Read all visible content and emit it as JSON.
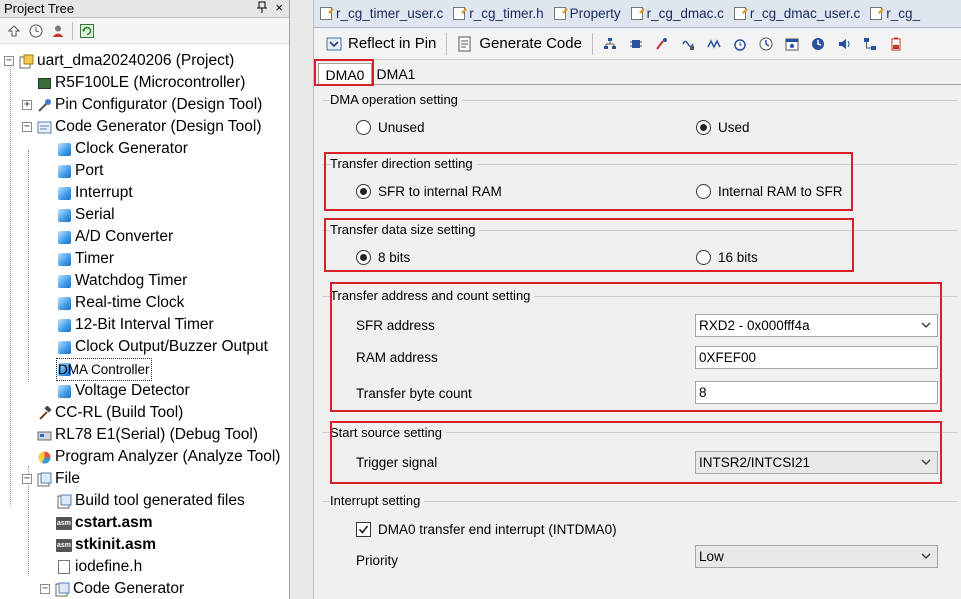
{
  "project_tree": {
    "title": "Project Tree",
    "pin_icon": "pin-icon",
    "close_label": "×",
    "nodes": [
      {
        "label": "uart_dma20240206 (Project)",
        "icon": "project-icon"
      },
      {
        "label": "R5F100LE (Microcontroller)",
        "icon": "microcontroller-icon"
      },
      {
        "label": "Pin Configurator (Design Tool)",
        "icon": "pin-configurator-icon"
      },
      {
        "label": "Code Generator (Design Tool)",
        "icon": "code-generator-icon"
      },
      {
        "label": "Clock Generator",
        "icon": "module-icon"
      },
      {
        "label": "Port",
        "icon": "module-icon"
      },
      {
        "label": "Interrupt",
        "icon": "module-icon"
      },
      {
        "label": "Serial",
        "icon": "module-icon"
      },
      {
        "label": "A/D Converter",
        "icon": "module-icon"
      },
      {
        "label": "Timer",
        "icon": "module-icon"
      },
      {
        "label": "Watchdog Timer",
        "icon": "module-icon"
      },
      {
        "label": "Real-time Clock",
        "icon": "module-icon"
      },
      {
        "label": "12-Bit Interval Timer",
        "icon": "module-icon"
      },
      {
        "label": "Clock Output/Buzzer Output",
        "icon": "module-icon"
      },
      {
        "label": "DMA Controller",
        "icon": "module-icon"
      },
      {
        "label": "Voltage Detector",
        "icon": "module-icon"
      },
      {
        "label": "CC-RL (Build Tool)",
        "icon": "build-tool-icon"
      },
      {
        "label": "RL78 E1(Serial) (Debug Tool)",
        "icon": "debug-tool-icon"
      },
      {
        "label": "Program Analyzer (Analyze Tool)",
        "icon": "analyzer-icon"
      },
      {
        "label": "File",
        "icon": "folder-icon"
      },
      {
        "label": "Build tool generated files",
        "icon": "folder-icon"
      },
      {
        "label": "cstart.asm",
        "icon": "asm-file-icon"
      },
      {
        "label": "stkinit.asm",
        "icon": "asm-file-icon"
      },
      {
        "label": "iodefine.h",
        "icon": "header-file-icon"
      },
      {
        "label": "Code Generator",
        "icon": "folder-icon"
      }
    ]
  },
  "file_tabs": [
    "r_cg_timer_user.c",
    "r_cg_timer.h",
    "Property",
    "r_cg_dmac.c",
    "r_cg_dmac_user.c",
    "r_cg_"
  ],
  "command_bar": {
    "reflect_label": "Reflect in Pin",
    "generate_label": "Generate Code"
  },
  "sub_tabs": [
    "DMA0",
    "DMA1"
  ],
  "form": {
    "dma_operation": {
      "title": "DMA operation setting",
      "options": [
        "Unused",
        "Used"
      ],
      "selected": "Used"
    },
    "transfer_direction": {
      "title": "Transfer direction setting",
      "options": [
        "SFR to internal RAM",
        "Internal RAM to SFR"
      ],
      "selected": "SFR to internal RAM"
    },
    "transfer_data_size": {
      "title": "Transfer data size setting",
      "options": [
        "8 bits",
        "16 bits"
      ],
      "selected": "8 bits"
    },
    "transfer_address": {
      "title": "Transfer address and count setting",
      "sfr_label": "SFR address",
      "sfr_value": "RXD2 - 0x000fff4a",
      "ram_label": "RAM address",
      "ram_value": "0XFEF00",
      "count_label": "Transfer byte count",
      "count_value": "8"
    },
    "start_source": {
      "title": "Start source setting",
      "trigger_label": "Trigger signal",
      "trigger_value": "INTSR2/INTCSI21"
    },
    "interrupt": {
      "title": "Interrupt setting",
      "checkbox_label": "DMA0 transfer end interrupt (INTDMA0)",
      "checkbox_checked": true,
      "priority_label": "Priority",
      "priority_value": "Low"
    }
  },
  "highlight_color": "#d9202a"
}
